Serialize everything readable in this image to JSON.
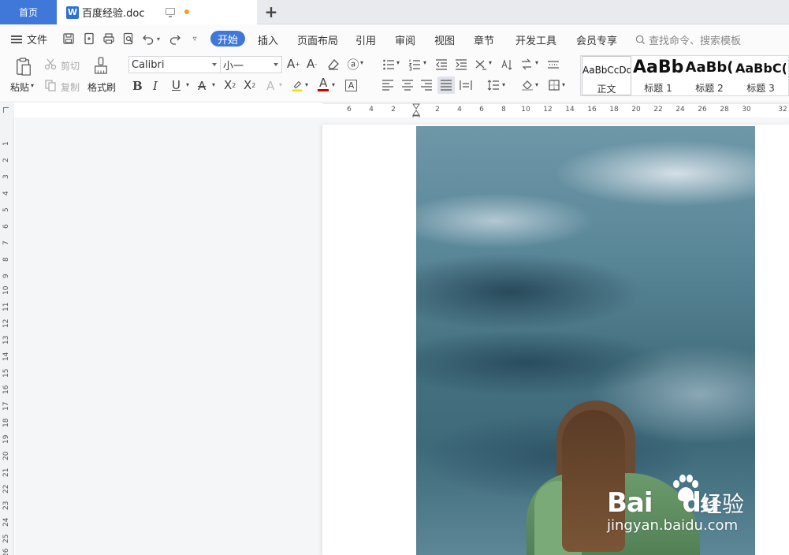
{
  "tabs": {
    "home": "首页",
    "document": "百度经验.doc"
  },
  "menu": {
    "file": "文件",
    "items": [
      "开始",
      "插入",
      "页面布局",
      "引用",
      "审阅",
      "视图",
      "章节",
      "开发工具",
      "会员专享"
    ],
    "search_placeholder": "查找命令、搜索模板"
  },
  "ribbon": {
    "paste": "粘贴",
    "cut": "剪切",
    "copy": "复制",
    "format_painter": "格式刷",
    "font_name": "Calibri",
    "font_size": "小一",
    "styles": [
      {
        "sample": "AaBbCcDd",
        "name": "正文"
      },
      {
        "sample": "AaBb",
        "name": "标题 1"
      },
      {
        "sample": "AaBb(",
        "name": "标题 2"
      },
      {
        "sample": "AaBbC(",
        "name": "标题 3"
      }
    ]
  },
  "ruler": {
    "horizontal": [
      "6",
      "4",
      "2",
      "2",
      "4",
      "6",
      "8",
      "10",
      "12",
      "14",
      "16",
      "18",
      "20",
      "22",
      "24",
      "26",
      "28",
      "30",
      "32"
    ],
    "vertical": [
      "1",
      "2",
      "3",
      "4",
      "5",
      "6",
      "7",
      "8",
      "9",
      "10",
      "11",
      "12",
      "13",
      "14",
      "15",
      "16",
      "17",
      "18",
      "19",
      "20",
      "21",
      "22",
      "23",
      "24",
      "25",
      "26"
    ]
  },
  "watermark": {
    "logo": "Bai",
    "logo2": "du",
    "suffix": "经验",
    "url": "jingyan.baidu.com"
  },
  "colors": {
    "accent": "#3f78d8",
    "tab_bg": "#e8eaee",
    "modified_dot": "#f0a020"
  }
}
